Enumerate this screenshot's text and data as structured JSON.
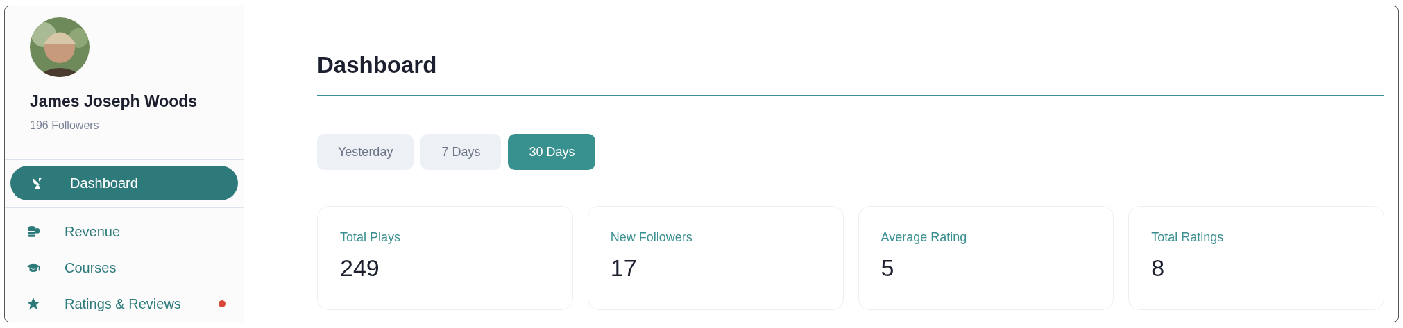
{
  "profile": {
    "name": "James Joseph Woods",
    "followers": "196 Followers"
  },
  "nav": [
    {
      "label": "Dashboard",
      "selected": true,
      "notification": false
    },
    {
      "label": "Revenue",
      "selected": false,
      "notification": false
    },
    {
      "label": "Courses",
      "selected": false,
      "notification": false
    },
    {
      "label": "Ratings & Reviews",
      "selected": false,
      "notification": true
    }
  ],
  "title": "Dashboard",
  "ranges": [
    {
      "label": "Yesterday",
      "selected": false
    },
    {
      "label": "7 Days",
      "selected": false
    },
    {
      "label": "30 Days",
      "selected": true
    }
  ],
  "stats": [
    {
      "label": "Total Plays",
      "value": "249"
    },
    {
      "label": "New Followers",
      "value": "17"
    },
    {
      "label": "Average Rating",
      "value": "5"
    },
    {
      "label": "Total Ratings",
      "value": "8"
    }
  ]
}
